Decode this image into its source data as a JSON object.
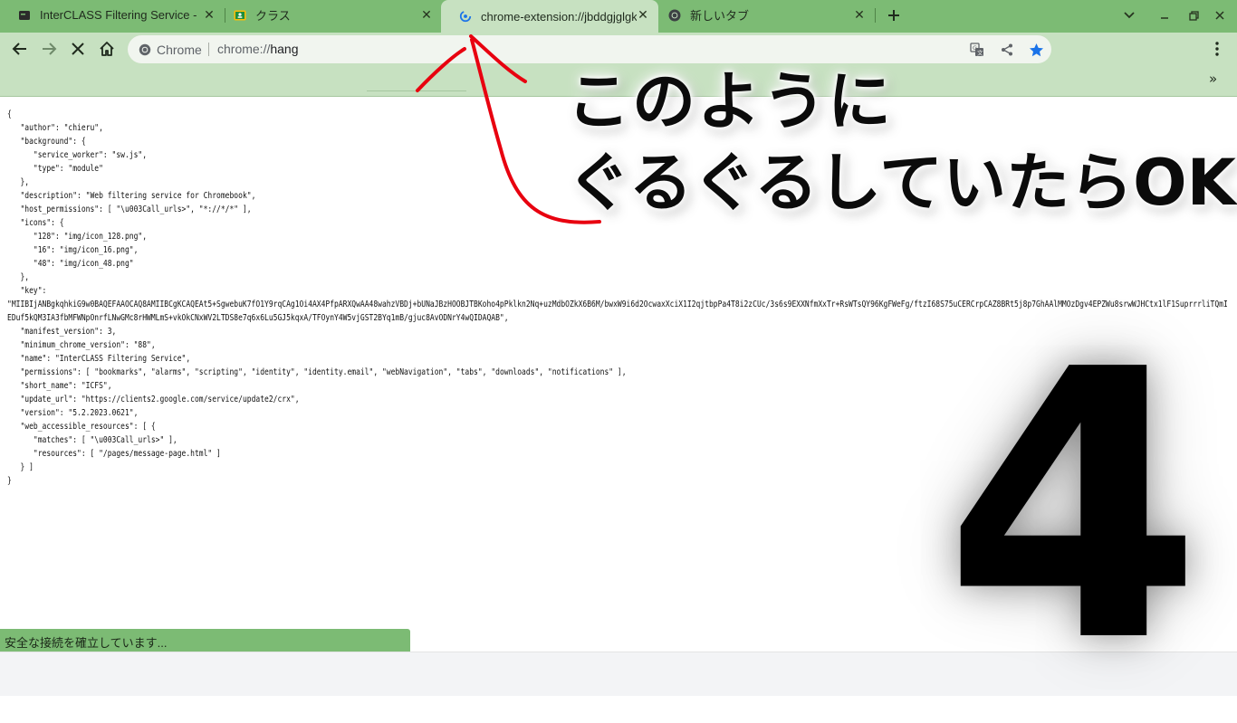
{
  "tabs": [
    {
      "title": "InterCLASS Filtering Service - E",
      "icon": "extension-favicon-icon",
      "active": false
    },
    {
      "title": "クラス",
      "icon": "classroom-icon",
      "active": false
    },
    {
      "title": "chrome-extension://jbddgjglgkk",
      "icon": "loading-spinner-icon",
      "active": true
    },
    {
      "title": "新しいタブ",
      "icon": "chrome-icon",
      "active": false
    }
  ],
  "toolbar": {
    "chip_label": "Chrome",
    "url_scheme": "chrome://",
    "url_host": "hang"
  },
  "json_text": "{\n   \"author\": \"chieru\",\n   \"background\": {\n      \"service_worker\": \"sw.js\",\n      \"type\": \"module\"\n   },\n   \"description\": \"Web filtering service for Chromebook\",\n   \"host_permissions\": [ \"\\u003Call_urls>\", \"*://*/*\" ],\n   \"icons\": {\n      \"128\": \"img/icon_128.png\",\n      \"16\": \"img/icon_16.png\",\n      \"48\": \"img/icon_48.png\"\n   },\n   \"key\":\n\"MIIBIjANBgkqhkiG9w0BAQEFAAOCAQ8AMIIBCgKCAQEAt5+SgwebuK7fO1Y9rqCAg1Oi4AX4PfpARXQwAA48wahzVBDj+bUNaJBzHOOBJTBKoho4pPklkn2Nq+uzMdbOZkX6B6M/bwxW9i6d2OcwaxXciX1I2qjtbpPa4T8i2zCUc/3s6s9EXXNfmXxTr+RsWTsQY96KgFWeFg/ftzI68S75uCERCrpCAZ8BRt5j8p7GhAAlMMOzDgv4EPZWu8srwWJHCtx1lF1SuprrrliTQmIEDuf5kQM3IA3fbMFWNpOnrfLNwGMc8rHWMLmS+vkOkCNxWV2LTDS8e7q6x6Lu5GJ5kqxA/TFOynY4W5vjGST2BYq1mB/gjuc8AvODNrY4wQIDAQAB\",\n   \"manifest_version\": 3,\n   \"minimum_chrome_version\": \"88\",\n   \"name\": \"InterCLASS Filtering Service\",\n   \"permissions\": [ \"bookmarks\", \"alarms\", \"scripting\", \"identity\", \"identity.email\", \"webNavigation\", \"tabs\", \"downloads\", \"notifications\" ],\n   \"short_name\": \"ICFS\",\n   \"update_url\": \"https://clients2.google.com/service/update2/crx\",\n   \"version\": \"5.2.2023.0621\",\n   \"web_accessible_resources\": [ {\n      \"matches\": [ \"\\u003Call_urls>\" ],\n      \"resources\": [ \"/pages/message-page.html\" ]\n   } ]\n}",
  "status_text": "安全な接続を確立しています...",
  "annotation": {
    "line1": "このように",
    "line2": "ぐるぐるしていたらOK",
    "step_number": "4"
  },
  "colors": {
    "frame": "#7cbb74",
    "active_tab": "#c7e1c1",
    "accent_blue": "#1a73e8",
    "annotation_red": "#e8000f"
  }
}
